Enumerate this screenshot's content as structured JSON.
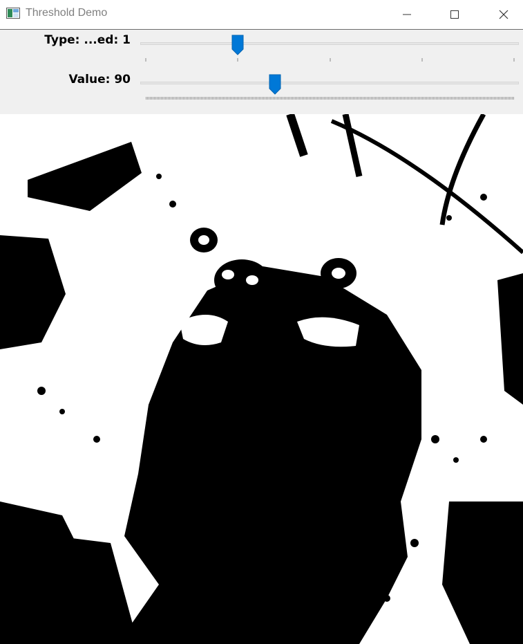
{
  "window": {
    "title": "Threshold Demo",
    "controls": [
      "minimize",
      "maximize",
      "close"
    ]
  },
  "trackbars": [
    {
      "label": "Type: ...ed: 1",
      "value": 1,
      "min": 0,
      "max": 4
    },
    {
      "label": "Value: 90",
      "value": 90,
      "min": 0,
      "max": 255
    }
  ],
  "colors": {
    "accent": "#0078d7",
    "panel": "#f0f0f0"
  },
  "image": {
    "description_icon": "thresholded-binary-image"
  }
}
